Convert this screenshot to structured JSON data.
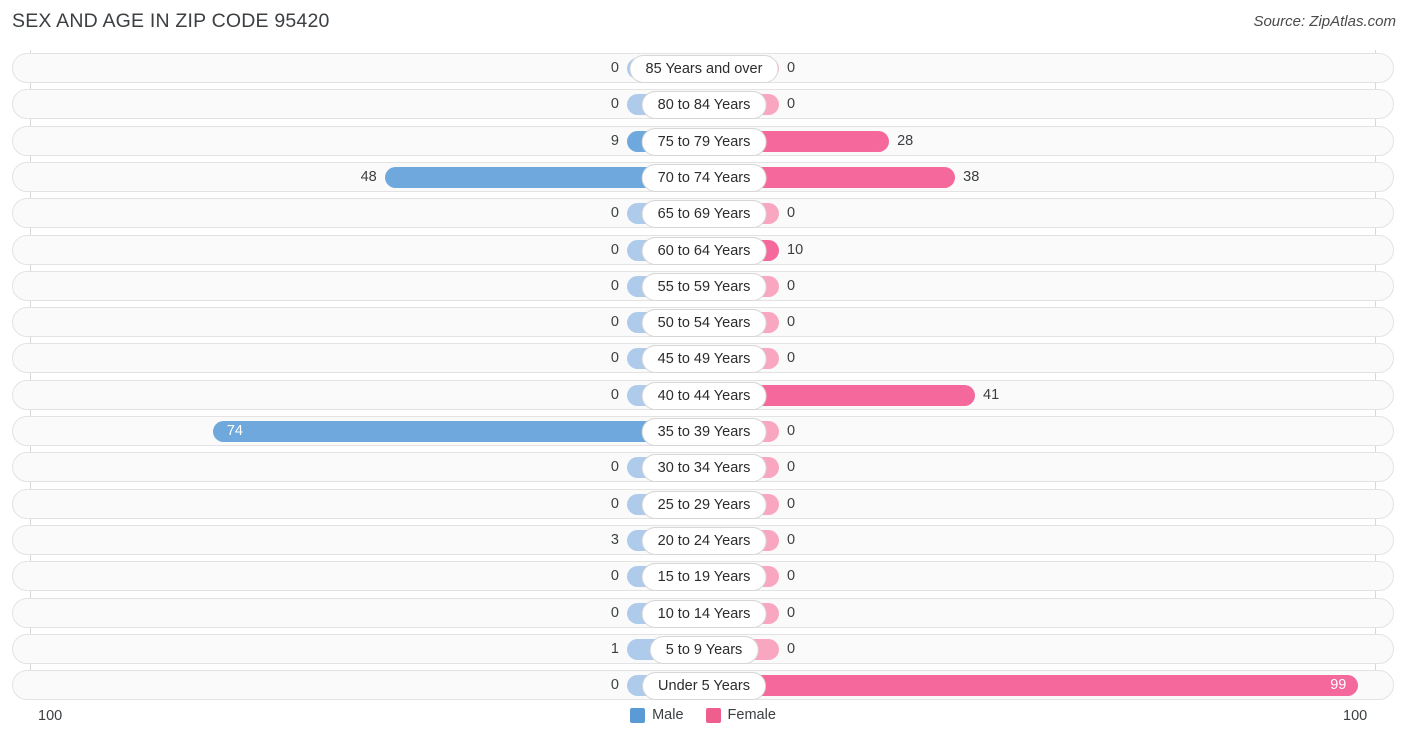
{
  "header": {
    "title": "SEX AND AGE IN ZIP CODE 95420",
    "source": "Source: ZipAtlas.com"
  },
  "legend": {
    "male_label": "Male",
    "female_label": "Female",
    "male_color": "#5a9bd5",
    "female_color": "#ef5f8d"
  },
  "axis": {
    "left_max_label": "100",
    "right_max_label": "100"
  },
  "colors": {
    "male_strong": "#6fa8dc",
    "male_faded": "#aecbeb",
    "female_strong": "#f4689b",
    "female_faded": "#f9a7c0",
    "track_fill": "#fafafa",
    "track_border": "#e3e3e3",
    "gridline": "#d8d8d8"
  },
  "chart_data": {
    "type": "bar",
    "title": "SEX AND AGE IN ZIP CODE 95420",
    "subtype": "population-pyramid",
    "xlabel": "",
    "ylabel": "",
    "xlim": [
      0,
      100
    ],
    "grid": true,
    "legend_position": "bottom-center",
    "categories": [
      "85 Years and over",
      "80 to 84 Years",
      "75 to 79 Years",
      "70 to 74 Years",
      "65 to 69 Years",
      "60 to 64 Years",
      "55 to 59 Years",
      "50 to 54 Years",
      "45 to 49 Years",
      "40 to 44 Years",
      "35 to 39 Years",
      "30 to 34 Years",
      "25 to 29 Years",
      "20 to 24 Years",
      "15 to 19 Years",
      "10 to 14 Years",
      "5 to 9 Years",
      "Under 5 Years"
    ],
    "series": [
      {
        "name": "Male",
        "values": [
          0,
          0,
          9,
          48,
          0,
          0,
          0,
          0,
          0,
          0,
          74,
          0,
          0,
          3,
          0,
          0,
          1,
          0
        ]
      },
      {
        "name": "Female",
        "values": [
          0,
          0,
          28,
          38,
          0,
          10,
          0,
          0,
          0,
          41,
          0,
          0,
          0,
          0,
          0,
          0,
          0,
          99
        ]
      }
    ]
  },
  "rows": [
    {
      "age": "85 Years and over",
      "male": "0",
      "female": "0"
    },
    {
      "age": "80 to 84 Years",
      "male": "0",
      "female": "0"
    },
    {
      "age": "75 to 79 Years",
      "male": "9",
      "female": "28"
    },
    {
      "age": "70 to 74 Years",
      "male": "48",
      "female": "38"
    },
    {
      "age": "65 to 69 Years",
      "male": "0",
      "female": "0"
    },
    {
      "age": "60 to 64 Years",
      "male": "0",
      "female": "10"
    },
    {
      "age": "55 to 59 Years",
      "male": "0",
      "female": "0"
    },
    {
      "age": "50 to 54 Years",
      "male": "0",
      "female": "0"
    },
    {
      "age": "45 to 49 Years",
      "male": "0",
      "female": "0"
    },
    {
      "age": "40 to 44 Years",
      "male": "0",
      "female": "41"
    },
    {
      "age": "35 to 39 Years",
      "male": "74",
      "female": "0"
    },
    {
      "age": "30 to 34 Years",
      "male": "0",
      "female": "0"
    },
    {
      "age": "25 to 29 Years",
      "male": "0",
      "female": "0"
    },
    {
      "age": "20 to 24 Years",
      "male": "3",
      "female": "0"
    },
    {
      "age": "15 to 19 Years",
      "male": "0",
      "female": "0"
    },
    {
      "age": "10 to 14 Years",
      "male": "0",
      "female": "0"
    },
    {
      "age": "5 to 9 Years",
      "male": "1",
      "female": "0"
    },
    {
      "age": "Under 5 Years",
      "male": "0",
      "female": "99"
    }
  ]
}
